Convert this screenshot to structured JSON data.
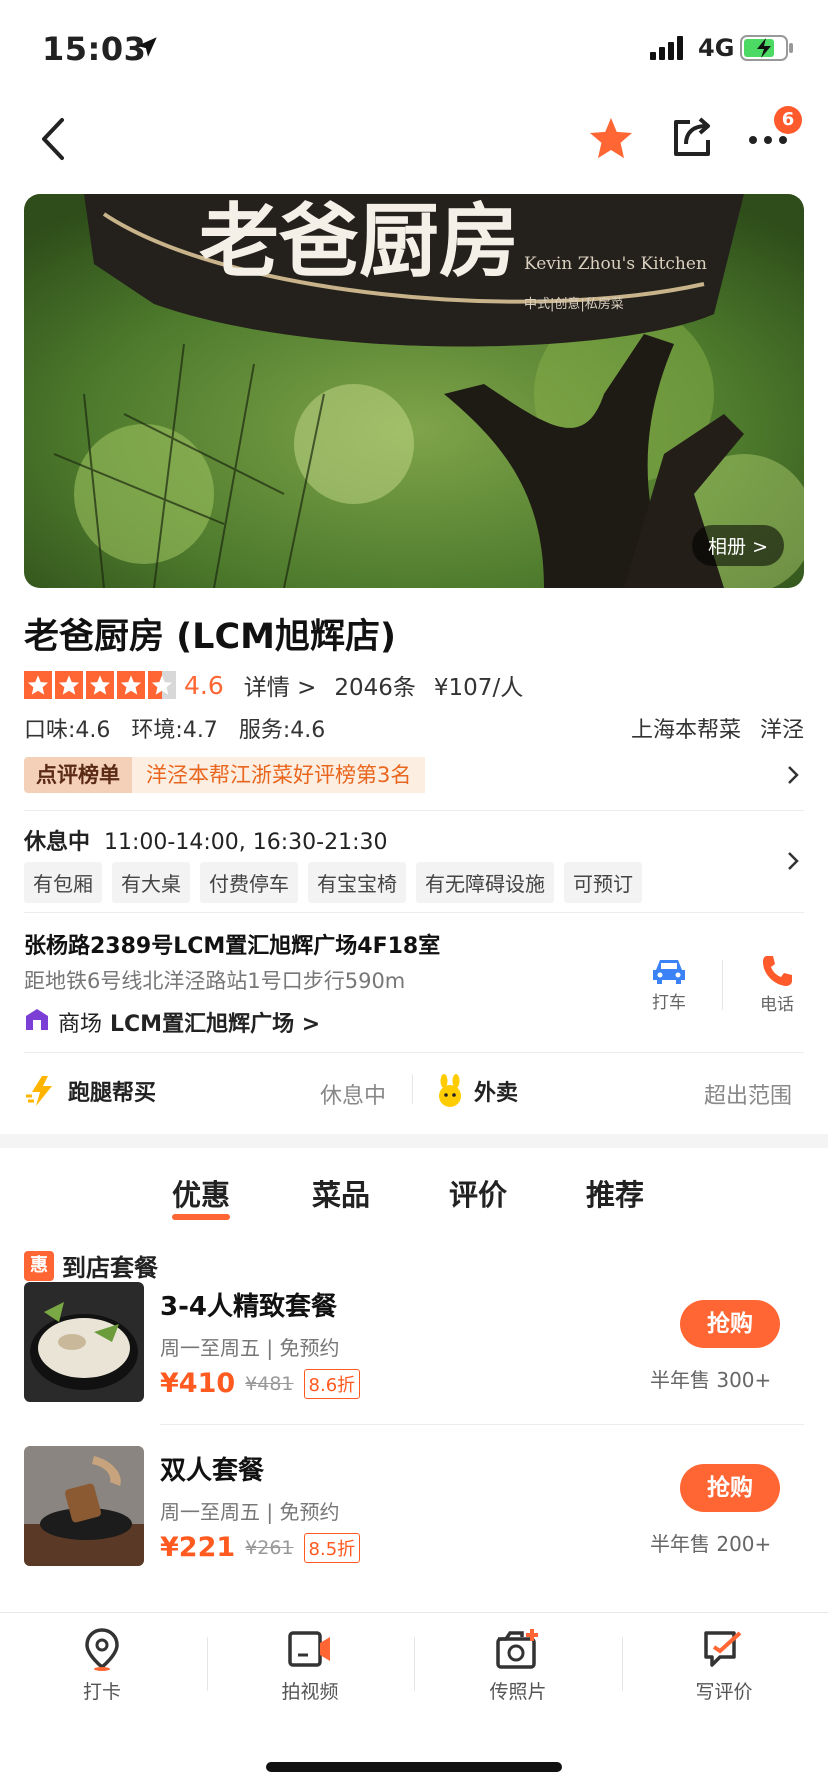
{
  "status": {
    "time": "15:03",
    "network": "4G"
  },
  "nav": {
    "badge_count": "6",
    "icons": [
      "back-icon",
      "star-icon",
      "share-icon",
      "more-icon"
    ]
  },
  "hero": {
    "sign_text_en": "Kevin Zhou's Kitchen",
    "sign_text_cn": "中式|创意|私房菜",
    "album_label": "相册 >"
  },
  "shop": {
    "title": "老爸厨房 (LCM旭辉店)",
    "rating": 4.6,
    "score_text": "4.6",
    "details_label": "详情 >",
    "review_count": "2046条",
    "per_person": "¥107/人",
    "taste": "口味:4.6",
    "environment": "环境:4.7",
    "service": "服务:4.6",
    "cuisine": "上海本帮菜",
    "area": "洋泾",
    "rank_tag": "点评榜单",
    "rank_text": "洋泾本帮江浙菜好评榜第3名"
  },
  "hours": {
    "state": "休息中",
    "time": "11:00-14:00, 16:30-21:30"
  },
  "facilities": [
    "有包厢",
    "有大桌",
    "付费停车",
    "有宝宝椅",
    "有无障碍设施",
    "可预订"
  ],
  "address": {
    "street": "张杨路2389号LCM置汇旭辉广场4F18室",
    "distance": "距地铁6号线北洋泾路站1号口步行590m",
    "mall_label": "商场",
    "mall_name": "LCM置汇旭辉广场 >",
    "taxi_label": "打车",
    "phone_label": "电话"
  },
  "services": {
    "errand_label": "跑腿帮买",
    "errand_status": "休息中",
    "delivery_label": "外卖",
    "delivery_status": "超出范围"
  },
  "tabs": [
    "优惠",
    "菜品",
    "评价",
    "推荐"
  ],
  "deals_section": {
    "badge": "惠",
    "title": "到店套餐"
  },
  "deals": [
    {
      "name": "3-4人精致套餐",
      "meta": "周一至周五 | 免预约",
      "price": "¥410",
      "original": "¥481",
      "discount": "8.6折",
      "buy_label": "抢购",
      "sold": "半年售 300+"
    },
    {
      "name": "双人套餐",
      "meta": "周一至周五 | 免预约",
      "price": "¥221",
      "original": "¥261",
      "discount": "8.5折",
      "buy_label": "抢购",
      "sold": "半年售 200+"
    }
  ],
  "bottom_bar": [
    {
      "label": "打卡",
      "icon": "location-pin-icon"
    },
    {
      "label": "拍视频",
      "icon": "video-camera-icon"
    },
    {
      "label": "传照片",
      "icon": "photo-upload-icon"
    },
    {
      "label": "写评价",
      "icon": "write-review-icon"
    }
  ],
  "colors": {
    "accent": "#ff6633",
    "badge": "#ff5a2b",
    "rank_bg": "#fdeee2"
  }
}
